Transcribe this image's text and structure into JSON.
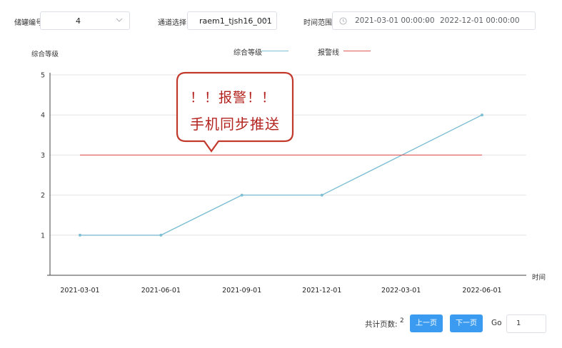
{
  "filters": {
    "storage_label": "储罐编号",
    "storage_value": "4",
    "channel_label": "通道选择",
    "channel_value": "raem1_tjsh16_001",
    "time_label": "时间范围",
    "time_start": "2021-03-01 00:00:00",
    "time_separator": "-",
    "time_end": "2022-12-01 00:00:00"
  },
  "icons": {
    "storage_dropdown": "chevron-down-icon",
    "channel_dropdown": "chevron-down-icon",
    "date_range": "clock-icon"
  },
  "callout": {
    "line1": "！！报警！！",
    "line2": "手机同步推送",
    "text_color": "#b3241f",
    "border_color": "#c0392b"
  },
  "chart_data": {
    "type": "line",
    "ylabel": "综合等级",
    "xlabel": "时间",
    "ylim": [
      0,
      5
    ],
    "yticks": [
      "1",
      "2",
      "3",
      "4",
      "5"
    ],
    "x": [
      "2021-03-01",
      "2021-06-01",
      "2021-09-01",
      "2021-12-01",
      "2022-03-01",
      "2022-06-01"
    ],
    "series": [
      {
        "name": "综合等级",
        "color": "#7fbfd3",
        "points": [
          {
            "x": "2021-03-01",
            "y": 1
          },
          {
            "x": "2021-06-01",
            "y": 1
          },
          {
            "x": "2021-09-01",
            "y": 2
          },
          {
            "x": "2021-12-01",
            "y": 2
          },
          {
            "x": "2022-06-01",
            "y": 4
          }
        ]
      },
      {
        "name": "报警线",
        "color": "#e05a5a",
        "points": [
          {
            "x": "2021-03-01",
            "y": 3
          },
          {
            "x": "2022-06-01",
            "y": 3
          }
        ]
      }
    ],
    "legend_position": "top-center",
    "grid": true
  },
  "pagination": {
    "total_label": "共计页数:",
    "total_value": "2",
    "prev_label": "上一页",
    "next_label": "下一页",
    "go_label": "Go",
    "page_input_value": "1",
    "button_color": "#3a9bf0"
  }
}
